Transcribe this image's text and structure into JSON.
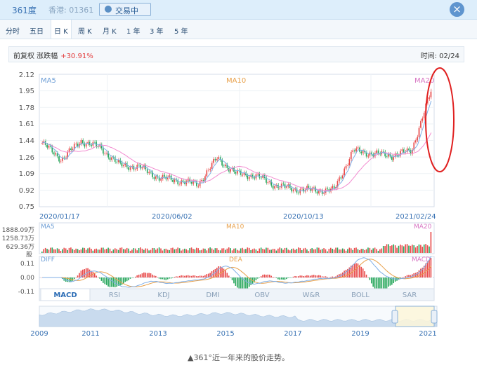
{
  "header": {
    "stock_name": "361度",
    "stock_code": "香港: 01361",
    "trade_button": "交易中",
    "close_icon": "close-icon"
  },
  "tabs": [
    {
      "label": "分时",
      "active": false
    },
    {
      "label": "五日",
      "active": false
    },
    {
      "label": "日 K",
      "active": true
    },
    {
      "label": "周 K",
      "active": false
    },
    {
      "label": "月 K",
      "active": false
    },
    {
      "label": "1 年",
      "active": false
    },
    {
      "label": "3 年",
      "active": false
    },
    {
      "label": "5 年",
      "active": false
    }
  ],
  "info": {
    "adjust_label": "前复权 涨跌幅",
    "change": "+30.91%",
    "time_label": "时间: 02/24"
  },
  "chart_data": {
    "type": "line",
    "price_axis": {
      "ticks": [
        "2.12",
        "1.95",
        "1.78",
        "1.61",
        "1.44",
        "1.26",
        "1.09",
        "0.92",
        "0.75"
      ],
      "ylim": [
        0.75,
        2.12
      ]
    },
    "ma_labels": [
      "MA5",
      "MA10",
      "MA20"
    ],
    "date_ticks": [
      "2020/01/17",
      "2020/06/02",
      "2020/10/13",
      "2021/02/24"
    ],
    "x": [
      "2020/01/17",
      "2020/02/10",
      "2020/03/02",
      "2020/03/23",
      "2020/04/14",
      "2020/05/06",
      "2020/06/02",
      "2020/06/20",
      "2020/07/10",
      "2020/07/30",
      "2020/08/20",
      "2020/09/10",
      "2020/10/13",
      "2020/11/05",
      "2020/11/25",
      "2020/12/15",
      "2021/01/05",
      "2021/01/20",
      "2021/02/05",
      "2021/02/18",
      "2021/02/24"
    ],
    "series": [
      {
        "name": "price",
        "values": [
          1.41,
          1.24,
          1.43,
          1.36,
          1.18,
          1.16,
          1.05,
          1.02,
          0.98,
          1.25,
          1.09,
          1.07,
          0.97,
          0.93,
          0.92,
          0.92,
          1.33,
          1.3,
          1.28,
          1.33,
          1.94
        ]
      }
    ],
    "volume_axis": {
      "ticks": [
        "1888.09万",
        "1258.73万",
        "629.36万",
        "股"
      ]
    },
    "macd_axis": {
      "ticks": [
        "0.11",
        "0.00",
        "-0.11"
      ]
    },
    "macd_labels": [
      "DIFF",
      "DEA",
      "MACD"
    ],
    "indicator_tabs": [
      "MACD",
      "RSI",
      "KDJ",
      "DMI",
      "OBV",
      "W&R",
      "BOLL",
      "SAR"
    ],
    "overview_years": [
      "2009",
      "2011",
      "2013",
      "2015",
      "2017",
      "2019",
      "2021"
    ]
  },
  "caption": "▲361°近一年来的股价走势。"
}
